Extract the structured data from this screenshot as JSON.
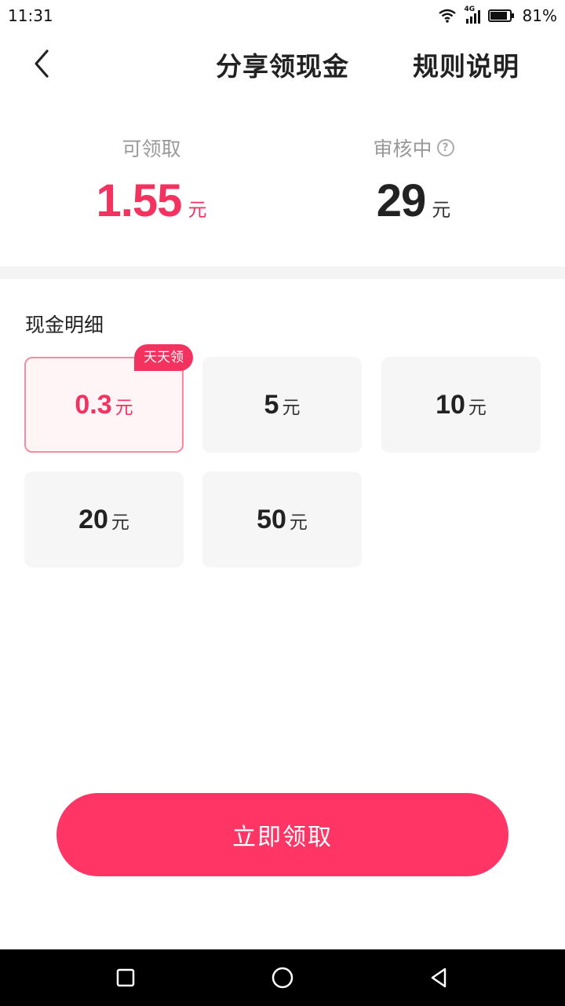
{
  "status_bar": {
    "time": "11:31",
    "network": "4G",
    "battery": "81%"
  },
  "header": {
    "title": "分享领现金",
    "rules_label": "规则说明"
  },
  "summary": {
    "available": {
      "label": "可领取",
      "value": "1.55",
      "unit": "元"
    },
    "pending": {
      "label": "审核中",
      "value": "29",
      "unit": "元"
    }
  },
  "cash_detail": {
    "title": "现金明细",
    "options": [
      {
        "value": "0.3",
        "unit": "元",
        "badge": "天天领",
        "selected": true
      },
      {
        "value": "5",
        "unit": "元"
      },
      {
        "value": "10",
        "unit": "元"
      },
      {
        "value": "20",
        "unit": "元"
      },
      {
        "value": "50",
        "unit": "元"
      }
    ]
  },
  "claim_button": {
    "label": "立即领取"
  },
  "colors": {
    "accent": "#f4325f",
    "button": "#fe3565",
    "card_bg": "#f6f6f6"
  },
  "icons": {
    "back": "chevron-left-icon",
    "help": "help-circle-icon",
    "sys_recent": "square-icon",
    "sys_home": "circle-icon",
    "sys_back": "triangle-back-icon"
  }
}
